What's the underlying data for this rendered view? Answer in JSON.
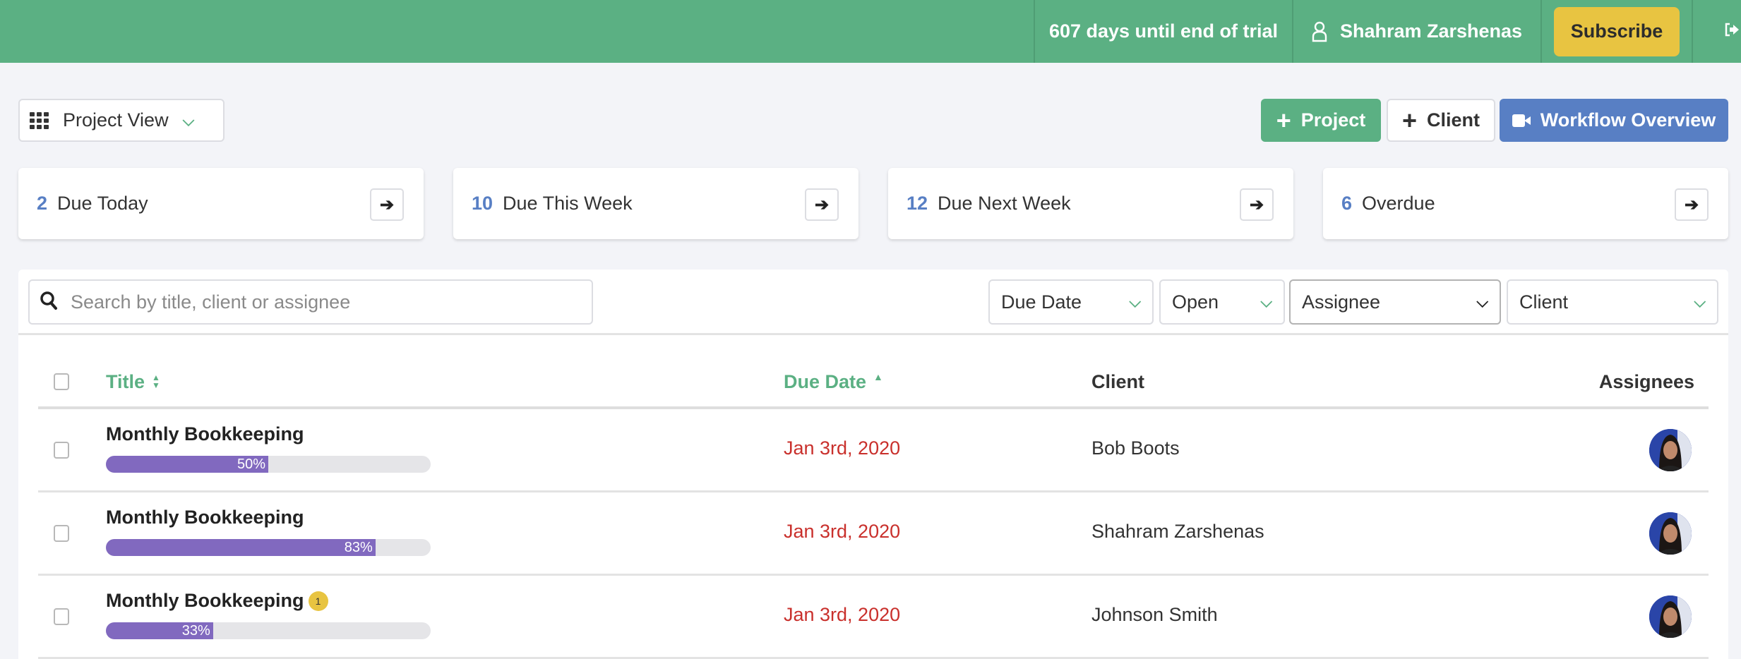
{
  "topbar": {
    "trial_text": "607 days until end of trial",
    "user_name": "Shahram Zarshenas",
    "subscribe_label": "Subscribe",
    "logout_icon": "sign-out-icon"
  },
  "toolbar": {
    "view_select": {
      "label": "Project View",
      "icon": "grid-icon"
    },
    "add_project_label": "Project",
    "add_client_label": "Client",
    "workflow_label": "Workflow Overview"
  },
  "stats": [
    {
      "count": "2",
      "label": "Due Today"
    },
    {
      "count": "10",
      "label": "Due This Week"
    },
    {
      "count": "12",
      "label": "Due Next Week"
    },
    {
      "count": "6",
      "label": "Overdue"
    }
  ],
  "filters": {
    "search_placeholder": "Search by title, client or assignee",
    "search_value": "",
    "due_date": "Due Date",
    "status": "Open",
    "assignee": "Assignee",
    "client": "Client"
  },
  "table": {
    "headers": {
      "title": "Title",
      "due_date": "Due Date",
      "client": "Client",
      "assignees": "Assignees"
    },
    "sort": {
      "column": "due_date",
      "direction": "ascending"
    },
    "rows": [
      {
        "title": "Monthly Bookkeeping",
        "progress_percent": 50,
        "progress_label": "50%",
        "badge": null,
        "due_date": "Jan 3rd, 2020",
        "client": "Bob Boots",
        "assignees": [
          "avatar"
        ]
      },
      {
        "title": "Monthly Bookkeeping",
        "progress_percent": 83,
        "progress_label": "83%",
        "badge": null,
        "due_date": "Jan 3rd, 2020",
        "client": "Shahram Zarshenas",
        "assignees": [
          "avatar"
        ]
      },
      {
        "title": "Monthly Bookkeeping",
        "progress_percent": 33,
        "progress_label": "33%",
        "badge": "1",
        "due_date": "Jan 3rd, 2020",
        "client": "Johnson Smith",
        "assignees": [
          "avatar"
        ]
      }
    ]
  },
  "colors": {
    "brand_green": "#5bb083",
    "accent_blue": "#587fc4",
    "subscribe_yellow": "#e8c441",
    "progress_purple": "#8169bf",
    "overdue_red": "#c9302c"
  }
}
